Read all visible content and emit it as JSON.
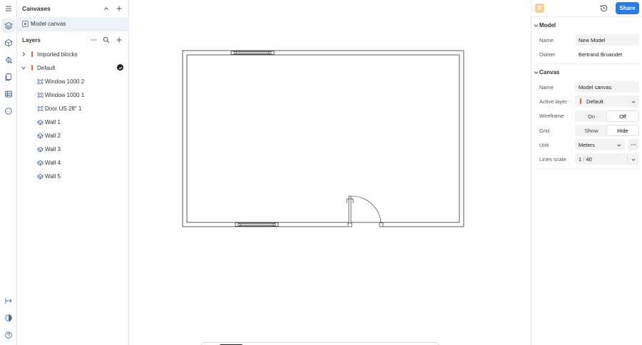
{
  "rail": {
    "icons": [
      "menu-icon",
      "layers-icon",
      "blocks-icon",
      "materials-icon",
      "catalog-icon",
      "pages-icon",
      "table-icon",
      "comments-icon",
      "measure-icon",
      "contrast-icon",
      "help-icon"
    ]
  },
  "left_panel": {
    "title": "Canvases",
    "canvas_item": "Model canvas",
    "layers_title": "Layers",
    "layers": [
      {
        "name": "Imported blocks",
        "color": "#e8603c",
        "expanded": false
      },
      {
        "name": "Default",
        "color": "#e8603c",
        "expanded": true,
        "active": true
      }
    ],
    "objects": [
      {
        "name": "Window 1000 2",
        "type": "block"
      },
      {
        "name": "Window 1000 1",
        "type": "block"
      },
      {
        "name": "Door US 28\" 1",
        "type": "block"
      },
      {
        "name": "Wall 1",
        "type": "wall"
      },
      {
        "name": "Wall 2",
        "type": "wall"
      },
      {
        "name": "Wall 3",
        "type": "wall"
      },
      {
        "name": "Wall 4",
        "type": "wall"
      },
      {
        "name": "Wall 5",
        "type": "wall"
      }
    ]
  },
  "right_panel": {
    "avatar_letter": "B",
    "share_label": "Share",
    "model": {
      "title": "Model",
      "name_label": "Name",
      "name_value": "New Model",
      "owner_label": "Owner",
      "owner_value": "Bertrand Bruandet"
    },
    "canvas": {
      "title": "Canvas",
      "name_label": "Name",
      "name_value": "Model canvas",
      "active_layer_label": "Active layer",
      "active_layer_value": "Default",
      "wireframe_label": "Wireframe",
      "wireframe_options": [
        "On",
        "Off"
      ],
      "wireframe_selected": "Off",
      "grid_label": "Grid",
      "grid_options": [
        "Show",
        "Hide"
      ],
      "grid_selected": "Hide",
      "unit_label": "Unit",
      "unit_value": "Meters",
      "lines_scale_label": "Lines scale",
      "lines_scale_value": "1 : 40"
    }
  },
  "colors": {
    "accent": "#2a7ce4",
    "layer": "#e8603c",
    "selected_row": "#eef3f9"
  }
}
